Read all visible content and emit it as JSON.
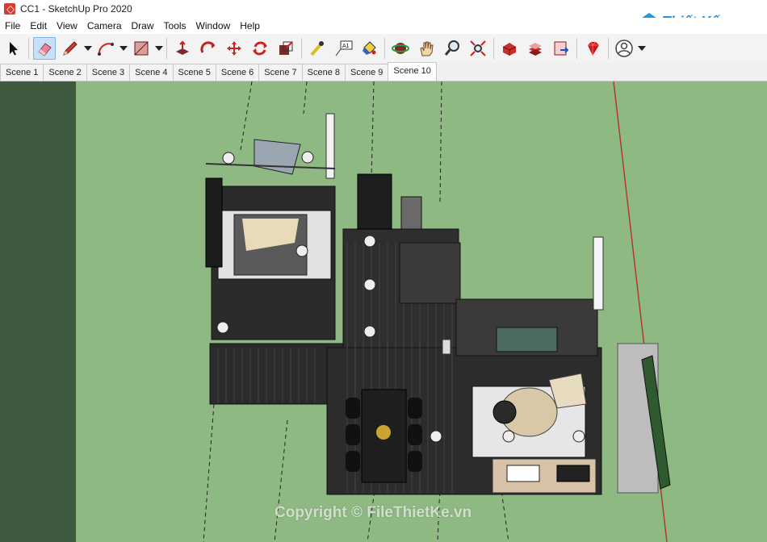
{
  "window": {
    "title": "CC1 - SketchUp Pro 2020"
  },
  "logo": {
    "mark": "File",
    "text": "Thiết Kế.vn"
  },
  "menu": [
    "File",
    "Edit",
    "View",
    "Camera",
    "Draw",
    "Tools",
    "Window",
    "Help"
  ],
  "toolbar": {
    "tools": [
      {
        "name": "select-tool",
        "icon": "arrow-icon"
      },
      {
        "name": "eraser-tool",
        "icon": "eraser-icon",
        "selected": true
      },
      {
        "name": "pencil-tool",
        "icon": "pencil-icon",
        "dropdown": true
      },
      {
        "name": "arc-tool",
        "icon": "arc-icon",
        "dropdown": true
      },
      {
        "name": "rectangle-tool",
        "icon": "rectangle-icon",
        "dropdown": true
      },
      {
        "name": "push-pull-tool",
        "icon": "push-pull-icon"
      },
      {
        "name": "follow-me-tool",
        "icon": "follow-me-icon"
      },
      {
        "name": "move-tool",
        "icon": "move-icon"
      },
      {
        "name": "rotate-tool",
        "icon": "rotate-icon"
      },
      {
        "name": "scale-tool",
        "icon": "scale-icon"
      },
      {
        "name": "tape-measure-tool",
        "icon": "tape-icon"
      },
      {
        "name": "text-tool",
        "icon": "text-icon"
      },
      {
        "name": "paint-bucket-tool",
        "icon": "paint-icon"
      },
      {
        "name": "orbit-tool",
        "icon": "orbit-icon"
      },
      {
        "name": "pan-tool",
        "icon": "hand-icon"
      },
      {
        "name": "zoom-tool",
        "icon": "zoom-icon"
      },
      {
        "name": "zoom-extents-tool",
        "icon": "zoom-extents-icon"
      },
      {
        "name": "warehouse-tool",
        "icon": "warehouse-icon"
      },
      {
        "name": "extension-warehouse-tool",
        "icon": "extension-icon"
      },
      {
        "name": "layout-tool",
        "icon": "layout-icon"
      },
      {
        "name": "ruby-tool",
        "icon": "ruby-icon"
      },
      {
        "name": "account-tool",
        "icon": "user-icon",
        "dropdown": true
      }
    ],
    "text_tool_label": "A1"
  },
  "scenes": [
    "Scene 1",
    "Scene 2",
    "Scene 3",
    "Scene 4",
    "Scene 5",
    "Scene 6",
    "Scene 7",
    "Scene 8",
    "Scene 9",
    "Scene 10"
  ],
  "active_scene": "Scene 10",
  "watermark": "Copyright © FileThietKe.vn",
  "colors": {
    "ground": "#8fb983",
    "ground_dark": "#3f5a3e",
    "floor": "#2d2d2d",
    "accent": "#d83b2f"
  }
}
